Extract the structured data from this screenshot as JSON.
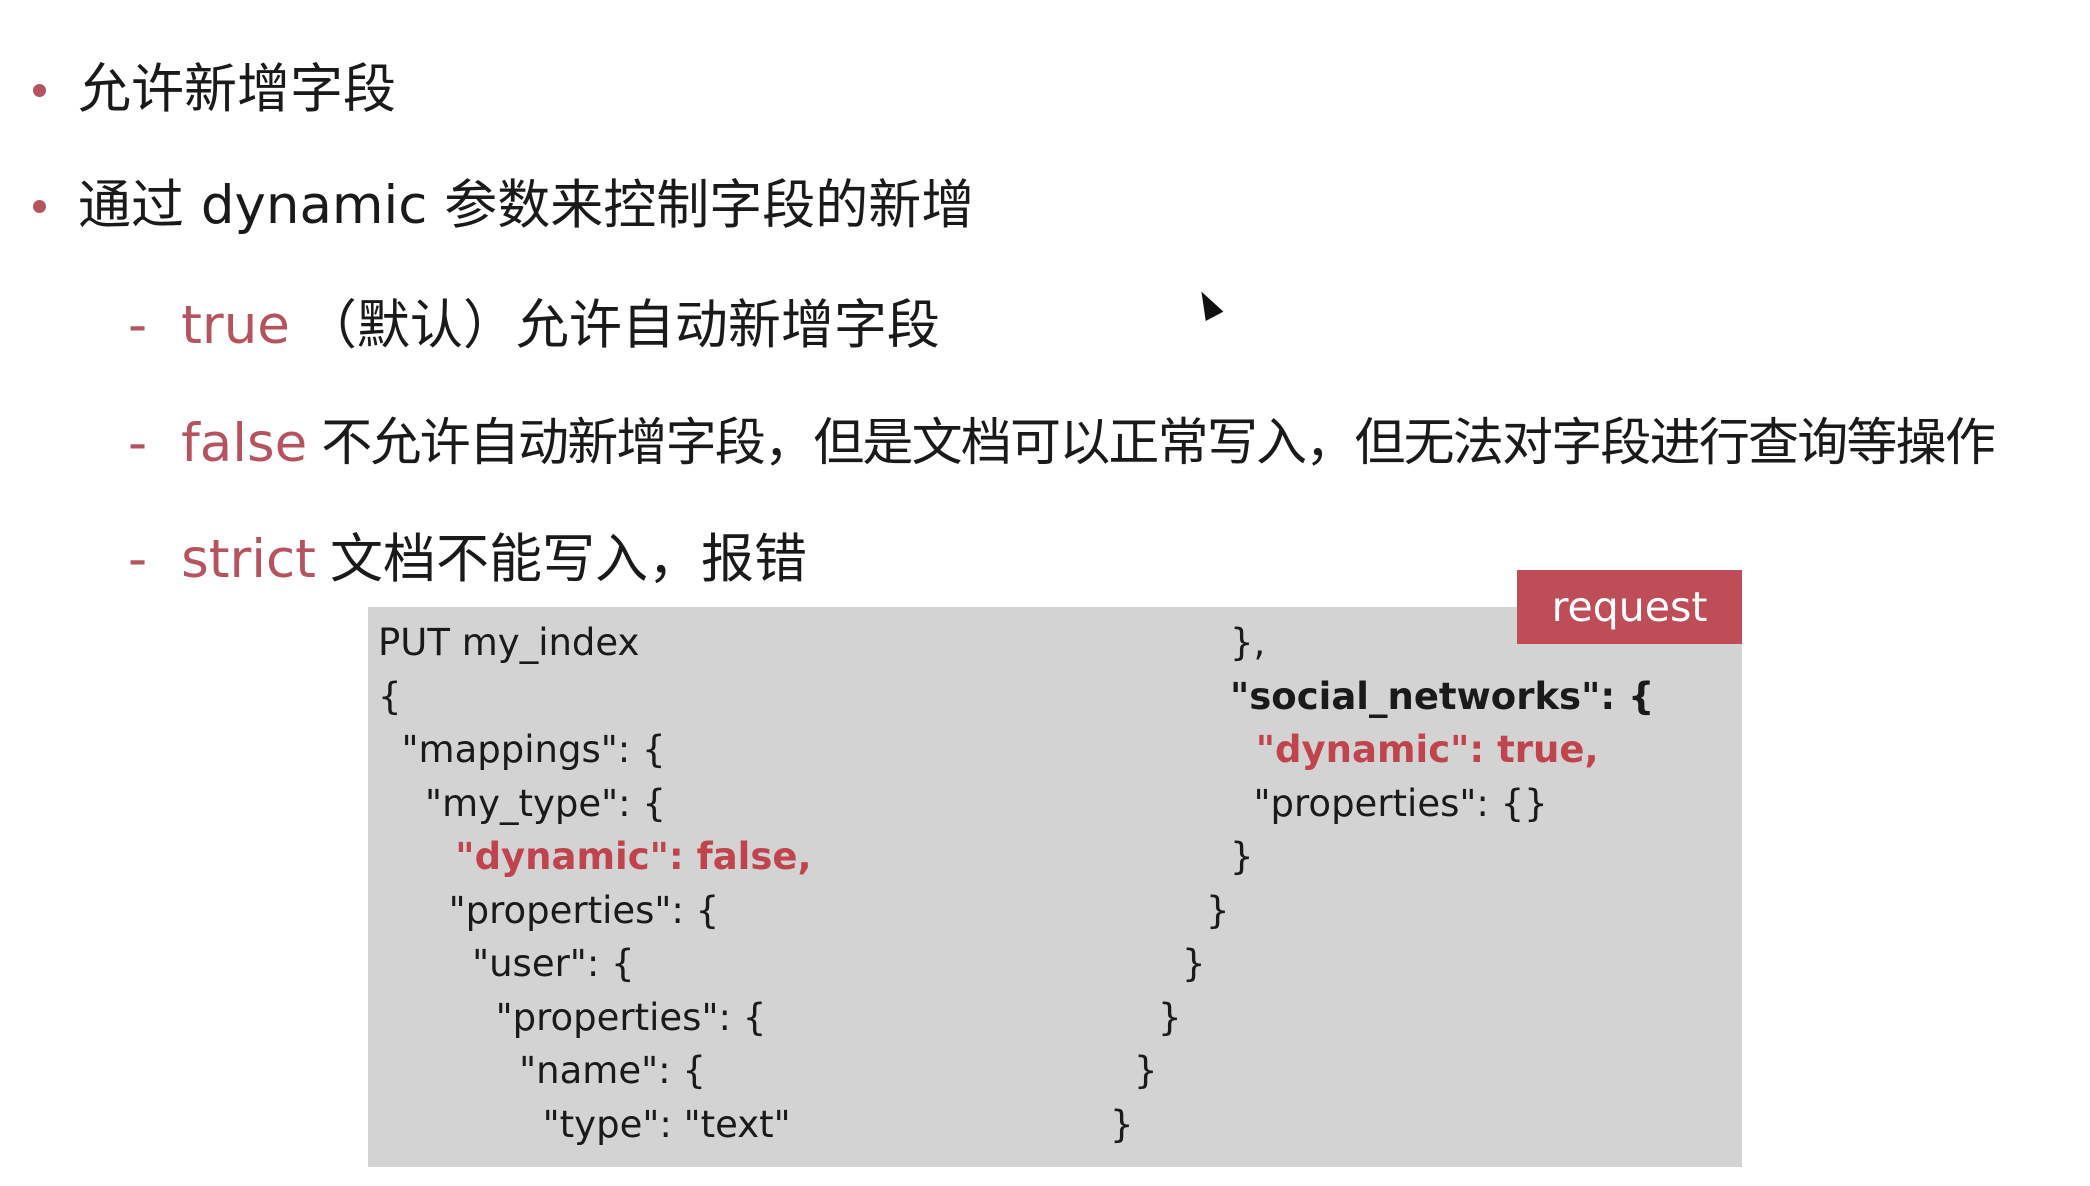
{
  "bullets": [
    {
      "text": "允许新增字段"
    },
    {
      "text": "通过 dynamic 参数来控制字段的新增"
    }
  ],
  "options": [
    {
      "dash": "-",
      "keyword": "true",
      "text": "（默认）允许自动新增字段"
    },
    {
      "dash": "-",
      "keyword": "false",
      "text": "不允许自动新增字段，但是文档可以正常写入，但无法对字段进行查询等操作"
    },
    {
      "dash": "-",
      "keyword": "strict",
      "text": "文档不能写入，报错"
    }
  ],
  "badge": {
    "label": "request"
  },
  "code_left": [
    "PUT my_index",
    "{",
    "  \"mappings\": {",
    "    \"my_type\": {",
    "      \"dynamic\": false,",
    "      \"properties\": {",
    "        \"user\": {",
    "          \"properties\": {",
    "            \"name\": {",
    "              \"type\": \"text\""
  ],
  "code_right": [
    "},",
    "\"social_networks\": {",
    "  \"dynamic\": true,",
    "  \"properties\": {}",
    "}",
    "}",
    "}",
    "}",
    "}",
    "}"
  ],
  "colors": {
    "accent": "#b5535e",
    "code_bg": "#d4d3d3",
    "badge_bg": "#bf4d57",
    "code_highlight": "#c0444e"
  }
}
